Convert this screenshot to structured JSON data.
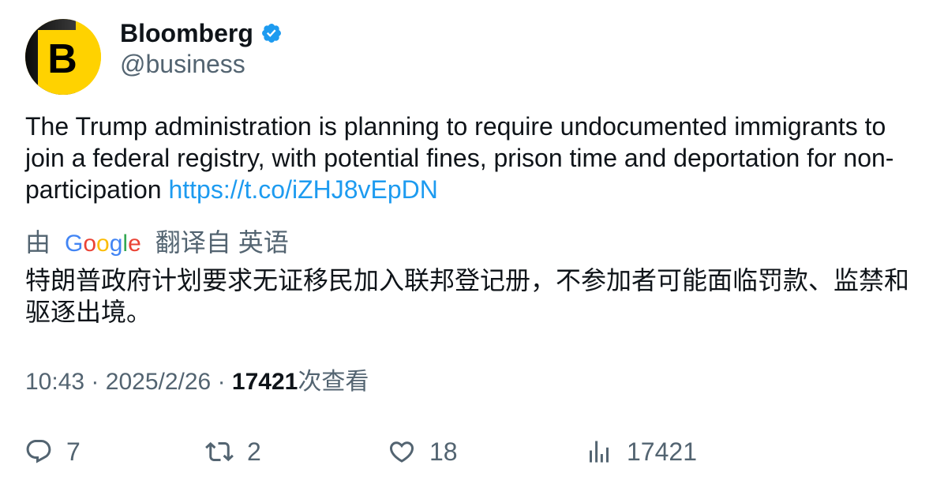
{
  "author": {
    "name": "Bloomberg",
    "handle": "@business",
    "avatar": {
      "letter": "B",
      "background": "#FFD200",
      "shadow": "#0a0a0a",
      "letter_color": "#000000"
    },
    "verified_icon": "verified-badge-icon",
    "verified_color": "#1D9BF0"
  },
  "tweet": {
    "text": "The Trump administration is planning to require undocumented immigrants to join a federal registry, with potential fines, prison time and deportation for non-participation",
    "link": "https://t.co/iZHJ8vEpDN"
  },
  "translation": {
    "prefix": "由",
    "provider": "Google",
    "provider_colors": [
      "#4285F4",
      "#EA4335",
      "#FBBC05",
      "#4285F4",
      "#34A853",
      "#EA4335"
    ],
    "translated_from": "翻译自",
    "language": "英语",
    "text": "特朗普政府计划要求无证移民加入联邦登记册，不参加者可能面临罚款、监禁和驱逐出境。"
  },
  "meta": {
    "time": "10:43",
    "separator": "·",
    "date": "2025/2/26",
    "views_count": "17421",
    "views_label": "次查看"
  },
  "actions": [
    {
      "name": "reply",
      "icon": "reply-icon",
      "count": "7"
    },
    {
      "name": "retweet",
      "icon": "retweet-icon",
      "count": "2"
    },
    {
      "name": "like",
      "icon": "heart-icon",
      "count": "18"
    },
    {
      "name": "views",
      "icon": "views-icon",
      "count": "17421"
    }
  ],
  "colors": {
    "text": "#0f1419",
    "secondary": "#536471",
    "link": "#1d9bf0"
  }
}
